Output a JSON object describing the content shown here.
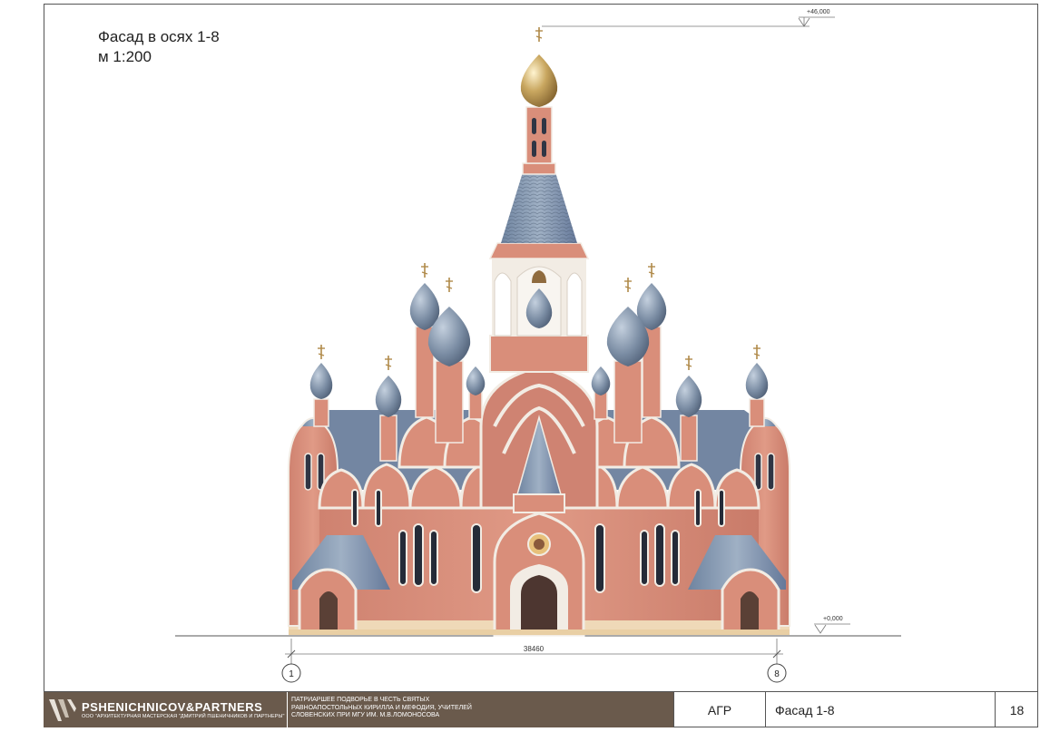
{
  "title": {
    "line1": "Фасад  в осях 1-8",
    "line2": "м 1:200"
  },
  "drawing": {
    "level_top": "+46,000",
    "level_ground": "+0,000",
    "dimension": "38460",
    "axis_left": "1",
    "axis_right": "8"
  },
  "stamp": {
    "firm_name": "PSHENICHNICOV&PARTNERS",
    "firm_sub": "ООО \"АРХИТЕКТУРНАЯ МАСТЕРСКАЯ \"ДМИТРИЙ ПШЕНИЧНИКОВ И ПАРТНЕРЫ\"",
    "project_lines": [
      "ПАТРИАРШЕЕ ПОДВОРЬЕ В ЧЕСТЬ СВЯТЫХ",
      "РАВНОАПОСТОЛЬНЫХ КИРИЛЛА И МЕФОДИЯ, УЧИТЕЛЕЙ",
      "СЛОВЕНСКИХ ПРИ МГУ ИМ. М.В.ЛОМОНОСОВА"
    ],
    "stage": "АГР",
    "sheet_title": "Фасад 1-8",
    "sheet_number": "18"
  },
  "colors": {
    "brick": "#d98e7a",
    "trim": "#f2ece4",
    "roof": "#7f93ab",
    "dome": "#7d8ea3",
    "gold": "#c8a45a",
    "stamp": "#6a5a4c"
  }
}
